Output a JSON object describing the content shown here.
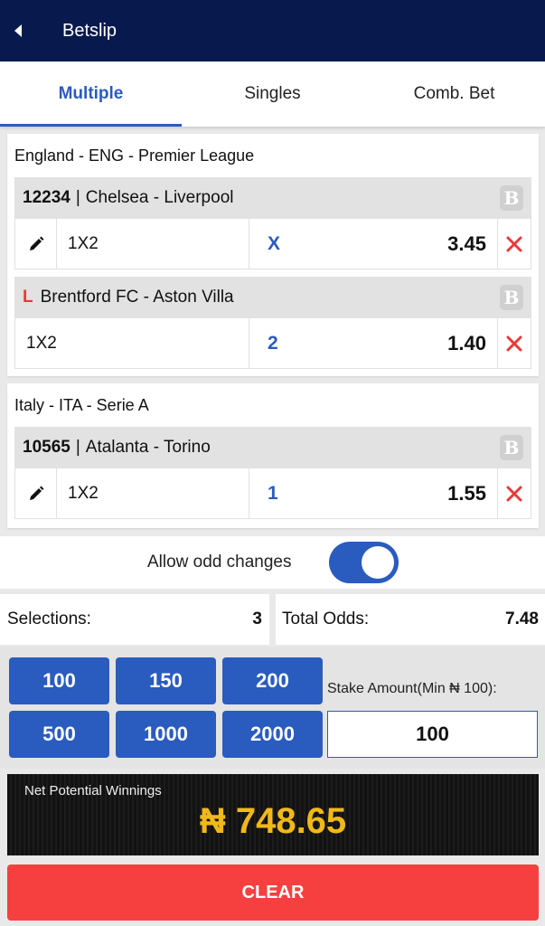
{
  "header": {
    "title": "Betslip",
    "back_icon": "chevron-left-icon"
  },
  "tabs": [
    {
      "label": "Multiple",
      "active": true
    },
    {
      "label": "Singles",
      "active": false
    },
    {
      "label": "Comb. Bet",
      "active": false
    }
  ],
  "groups": [
    {
      "league": "England - ENG - Premier League",
      "events": [
        {
          "code": "12234",
          "separator": "|",
          "match": "Chelsea - Liverpool",
          "market": "1X2",
          "outcome": "X",
          "odd": "3.45",
          "badge": "B"
        },
        {
          "live": "L",
          "match": "Brentford FC - Aston Villa",
          "market": "1X2",
          "outcome": "2",
          "odd": "1.40",
          "badge": "B"
        }
      ]
    },
    {
      "league": "Italy - ITA - Serie A",
      "events": [
        {
          "code": "10565",
          "separator": "|",
          "match": "Atalanta - Torino",
          "market": "1X2",
          "outcome": "1",
          "odd": "1.55",
          "badge": "B"
        }
      ]
    }
  ],
  "odd_changes": {
    "label": "Allow odd changes",
    "enabled": true
  },
  "summary": {
    "selections_label": "Selections:",
    "selections_value": "3",
    "total_odds_label": "Total Odds:",
    "total_odds_value": "7.48"
  },
  "quick_stakes": [
    "100",
    "150",
    "200",
    "500",
    "1000",
    "2000"
  ],
  "stake": {
    "label": "Stake Amount(Min ₦ 100):",
    "value": "100"
  },
  "winnings": {
    "label": "Net Potential Winnings",
    "amount": "₦ 748.65"
  },
  "clear_label": "CLEAR",
  "colors": {
    "header_bg": "#081a4d",
    "accent": "#2a5bbf",
    "remove": "#e8393a",
    "winnings": "#f1b81a",
    "clear_bg": "#f64040"
  }
}
